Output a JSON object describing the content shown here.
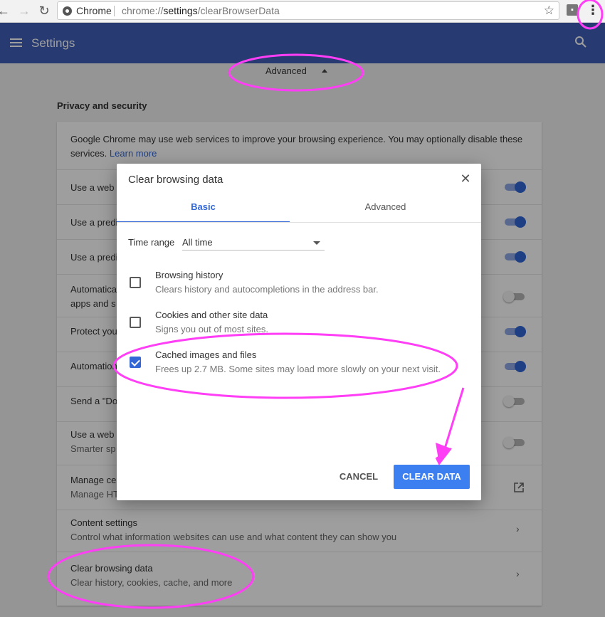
{
  "browser": {
    "tab_brand": "Chrome",
    "url_prefix": "chrome://",
    "url_host": "settings",
    "url_path": "/clearBrowserData",
    "back_icon": "←",
    "forward_icon": "→",
    "reload_icon": "↻",
    "star_icon": "☆",
    "menu_icon": "⋮"
  },
  "header": {
    "title": "Settings"
  },
  "advanced": {
    "label": "Advanced"
  },
  "privacy": {
    "section_title": "Privacy and security",
    "intro": "Google Chrome may use web services to improve your browsing experience. You may optionally disable these",
    "intro_line2": "services.",
    "learn_more": "Learn more",
    "rows": [
      {
        "line1": "Use a web s",
        "toggle": "on"
      },
      {
        "line1": "Use a predi",
        "toggle": "on"
      },
      {
        "line1": "Use a predi",
        "toggle": "on"
      },
      {
        "line1": "Automatica",
        "line2": "apps and s",
        "toggle": "off"
      },
      {
        "line1": "Protect you",
        "toggle": "on"
      },
      {
        "line1": "Automation",
        "toggle": "on"
      },
      {
        "line1": "Send a \"Do",
        "toggle": "off"
      },
      {
        "line1": "Use a web s",
        "line2": "Smarter sp",
        "toggle": "off"
      },
      {
        "line1": "Manage ce",
        "line2": "Manage HT"
      }
    ],
    "content_settings": {
      "title": "Content settings",
      "desc": "Control what information websites can use and what content they can show you"
    },
    "clear_data": {
      "title": "Clear browsing data",
      "desc": "Clear history, cookies, cache, and more"
    }
  },
  "dialog": {
    "title": "Clear browsing data",
    "close_icon": "✕",
    "tabs": [
      "Basic",
      "Advanced"
    ],
    "time_range_label": "Time range",
    "time_range_value": "All time",
    "options": [
      {
        "title": "Browsing history",
        "desc": "Clears history and autocompletions in the address bar.",
        "checked": false
      },
      {
        "title": "Cookies and other site data",
        "desc": "Signs you out of most sites.",
        "checked": false
      },
      {
        "title": "Cached images and files",
        "desc": "Frees up 2.7 MB. Some sites may load more slowly on your next visit.",
        "checked": true
      }
    ],
    "cancel_label": "CANCEL",
    "clear_label": "CLEAR DATA"
  },
  "colors": {
    "header": "#3f60b8",
    "accent": "#3367d6",
    "button": "#3b7ff0",
    "annotation": "#ff3ef5"
  }
}
